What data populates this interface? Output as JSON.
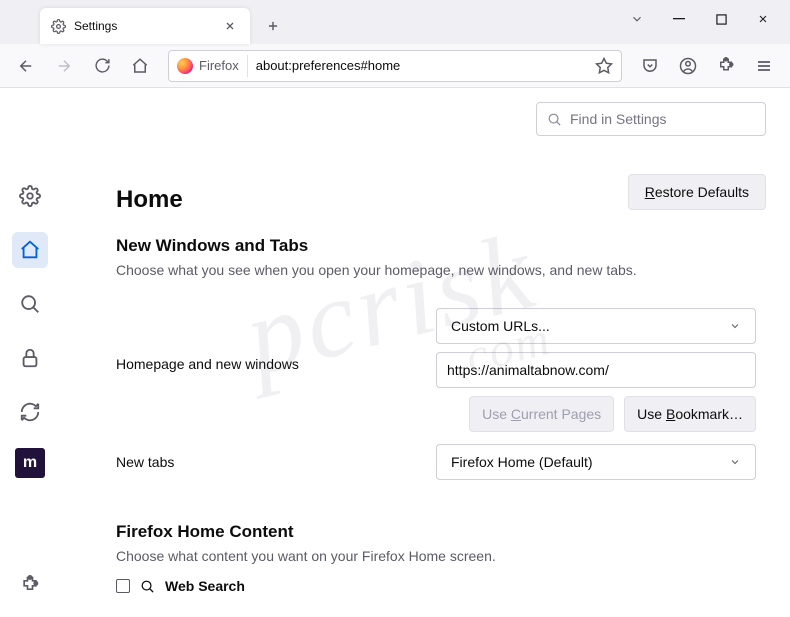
{
  "tab": {
    "title": "Settings"
  },
  "urlbar": {
    "identity": "Firefox",
    "url": "about:preferences#home"
  },
  "search": {
    "placeholder": "Find in Settings"
  },
  "header": {
    "title": "Home",
    "restore": "Restore Defaults"
  },
  "section1": {
    "heading": "New Windows and Tabs",
    "sub": "Choose what you see when you open your homepage, new windows, and new tabs.",
    "row1_label": "Homepage and new windows",
    "row1_select": "Custom URLs...",
    "row1_input": "https://animaltabnow.com/",
    "btn_current": "Use Current Pages",
    "btn_bookmark": "Use Bookmark…",
    "row2_label": "New tabs",
    "row2_select": "Firefox Home (Default)"
  },
  "section2": {
    "heading": "Firefox Home Content",
    "sub": "Choose what content you want on your Firefox Home screen.",
    "check1": "Web Search"
  },
  "moz": "m"
}
